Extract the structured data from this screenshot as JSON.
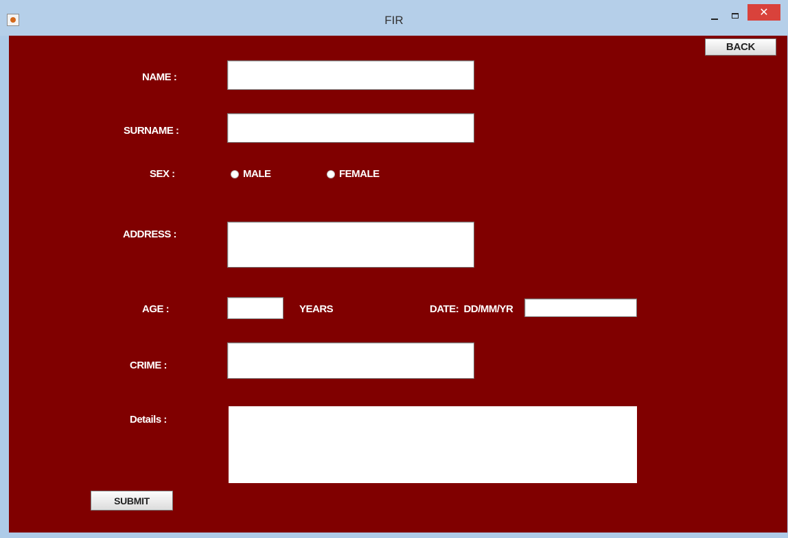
{
  "window": {
    "title": "FIR",
    "close_glyph": "✕"
  },
  "form": {
    "back_label": "BACK",
    "name_label": "NAME :",
    "surname_label": "SURNAME :",
    "sex_label": "SEX :",
    "sex_options": [
      "MALE",
      "FEMALE"
    ],
    "address_label": "ADDRESS :",
    "age_label": "AGE :",
    "years_label": "YEARS",
    "date_label": "DATE:  DD/MM/YR",
    "crime_label": "CRIME :",
    "details_label": "Details :",
    "submit_label": "SUBMIT",
    "values": {
      "name": "",
      "surname": "",
      "address": "",
      "age": "",
      "date": "",
      "crime": "",
      "details": ""
    }
  },
  "colors": {
    "panel": "#800000",
    "titlebar": "#b5cfe9",
    "close": "#d9423b"
  },
  "icons": {
    "app": "java-app-icon",
    "minimize": "minimize-icon",
    "maximize": "maximize-icon",
    "close": "close-icon"
  }
}
